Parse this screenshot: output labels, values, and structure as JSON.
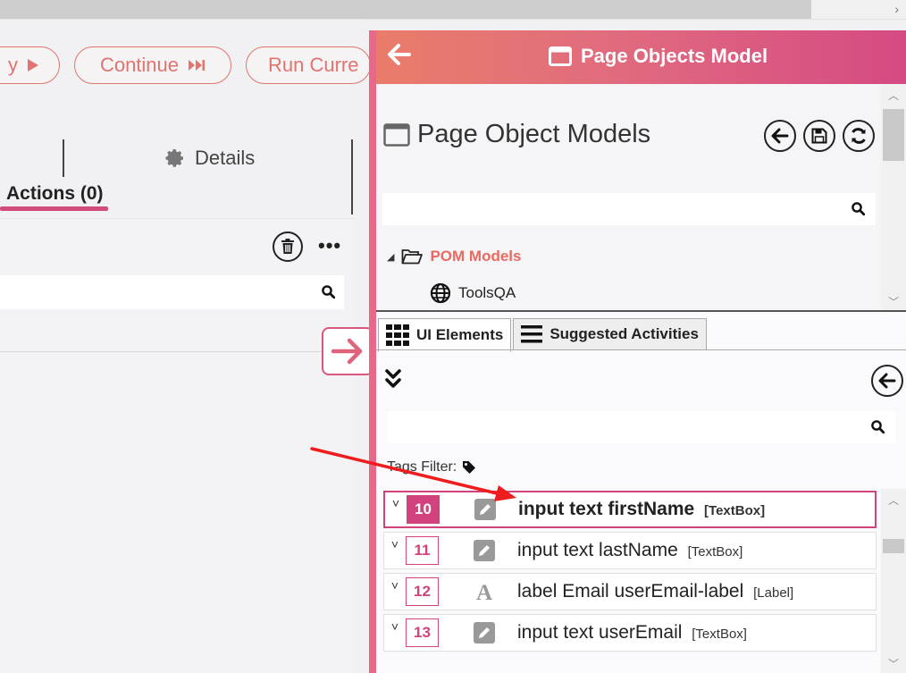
{
  "toolbar": {
    "replay_label": "y",
    "continue_label": "Continue",
    "run_current_label": "Run Curre"
  },
  "left_panel": {
    "details_tab": "Details",
    "actions_tab": "Actions (0)"
  },
  "pom": {
    "header_title": "Page Objects Model",
    "models_title": "Page Object Models",
    "tree_root": "POM Models",
    "tree_child": "ToolsQA"
  },
  "tabs": {
    "ui_elements": "UI Elements",
    "suggested_activities": "Suggested Activities"
  },
  "tags_filter_label": "Tags Filter:",
  "elements": [
    {
      "number": "10",
      "name": "input text firstName",
      "type": "[TextBox]",
      "icon": "pencil-icon",
      "selected": true
    },
    {
      "number": "11",
      "name": "input text lastName",
      "type": "[TextBox]",
      "icon": "pencil-icon",
      "selected": false
    },
    {
      "number": "12",
      "name": "label Email userEmail-label",
      "type": "[Label]",
      "icon": "label-icon",
      "selected": false
    },
    {
      "number": "13",
      "name": "input text userEmail",
      "type": "[TextBox]",
      "icon": "pencil-icon",
      "selected": false
    }
  ],
  "colors": {
    "accent": "#d2427d",
    "header_start": "#ea7c6a",
    "header_end": "#d54a83",
    "pill": "#e0746f",
    "annotation_arrow": "#ee1c1c"
  }
}
